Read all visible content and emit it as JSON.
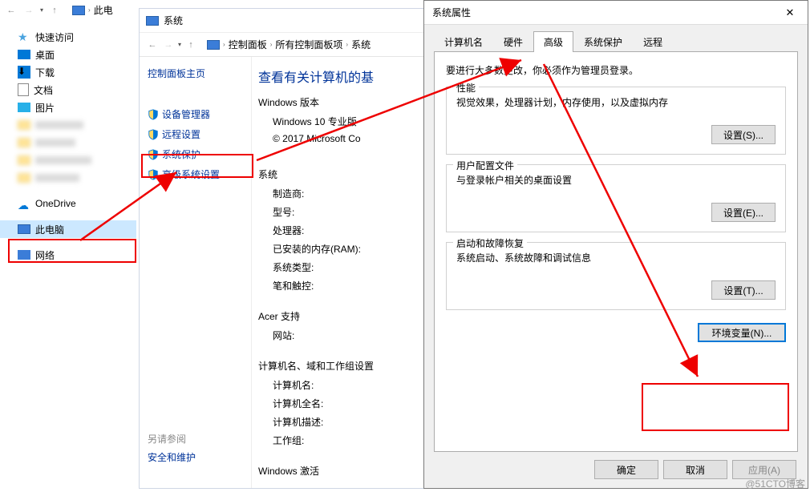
{
  "explorer": {
    "path_root": "此电",
    "quick_access": "快速访问",
    "desktop": "桌面",
    "downloads": "下载",
    "documents": "文档",
    "pictures": "图片",
    "onedrive": "OneDrive",
    "this_pc": "此电脑",
    "network": "网络"
  },
  "system_window": {
    "title": "系统",
    "breadcrumb": [
      "控制面板",
      "所有控制面板项",
      "系统"
    ],
    "sidebar_home": "控制面板主页",
    "sidebar_links": [
      "设备管理器",
      "远程设置",
      "系统保护",
      "高级系统设置"
    ],
    "heading": "查看有关计算机的基",
    "version_section": "Windows 版本",
    "version_line1": "Windows 10 专业版",
    "version_line2": "© 2017 Microsoft Co",
    "sys_section": "系统",
    "sys_items": [
      "制造商:",
      "型号:",
      "处理器:",
      "已安装的内存(RAM):",
      "系统类型:",
      "笔和触控:"
    ],
    "acer_section": "Acer 支持",
    "acer_items": [
      "网站:"
    ],
    "name_section": "计算机名、域和工作组设置",
    "name_items": [
      "计算机名:",
      "计算机全名:",
      "计算机描述:",
      "工作组:"
    ],
    "activation_section": "Windows 激活",
    "see_also": "另请参阅",
    "see_also_link": "安全和维护"
  },
  "dialog": {
    "title": "系统属性",
    "tabs": [
      "计算机名",
      "硬件",
      "高级",
      "系统保护",
      "远程"
    ],
    "admin_note": "要进行大多数更改，你必须作为管理员登录。",
    "perf_title": "性能",
    "perf_text": "视觉效果，处理器计划，内存使用，以及虚拟内存",
    "btn_settings_s": "设置(S)...",
    "profile_title": "用户配置文件",
    "profile_text": "与登录帐户相关的桌面设置",
    "btn_settings_e": "设置(E)...",
    "startup_title": "启动和故障恢复",
    "startup_text": "系统启动、系统故障和调试信息",
    "btn_settings_t": "设置(T)...",
    "btn_env": "环境变量(N)...",
    "btn_ok": "确定",
    "btn_cancel": "取消",
    "btn_apply": "应用(A)"
  },
  "watermark": "@51CTO博客"
}
